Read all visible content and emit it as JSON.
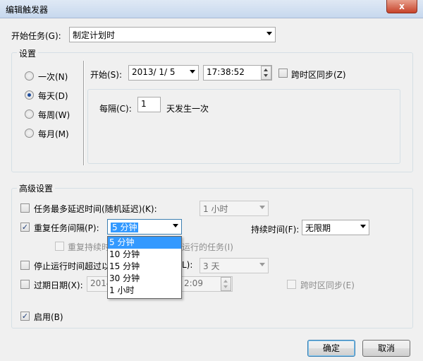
{
  "window": {
    "title": "编辑触发器",
    "close_glyph": "x"
  },
  "begin_task": {
    "label": "开始任务(G):",
    "value": "制定计划时"
  },
  "settings": {
    "group_title": "设置",
    "radios": [
      {
        "label": "一次(N)",
        "selected": false
      },
      {
        "label": "每天(D)",
        "selected": true
      },
      {
        "label": "每周(W)",
        "selected": false
      },
      {
        "label": "每月(M)",
        "selected": false
      }
    ],
    "start_label": "开始(S):",
    "start_date": "2013/ 1/ 5",
    "start_time": "17:38:52",
    "sync_label": "跨时区同步(Z)",
    "recur_label": "每隔(C):",
    "recur_value": "1",
    "recur_suffix": "天发生一次"
  },
  "advanced": {
    "group_title": "高级设置",
    "delay_label": "任务最多延迟时间(随机延迟)(K):",
    "delay_value": "1 小时",
    "repeat_label": "重复任务间隔(P):",
    "repeat_value": "5 分钟",
    "duration_label": "持续时间(F):",
    "duration_value": "无限期",
    "stop_all_label_left": "重复持续时",
    "stop_all_label_right": "运行的任务(I)",
    "stop_label": "停止运行时间超过以",
    "stop_label_tail": "L):",
    "stop_value": "3 天",
    "expire_label": "过期日期(X):",
    "expire_date": "2014",
    "expire_time": "2:09",
    "expire_sync_label": "跨时区同步(E)",
    "enabled_label": "启用(B)"
  },
  "repeat_dropdown": {
    "options": [
      "5 分钟",
      "10 分钟",
      "15 分钟",
      "30 分钟",
      "1 小时"
    ],
    "selected_index": 0
  },
  "buttons": {
    "ok": "确定",
    "cancel": "取消"
  }
}
